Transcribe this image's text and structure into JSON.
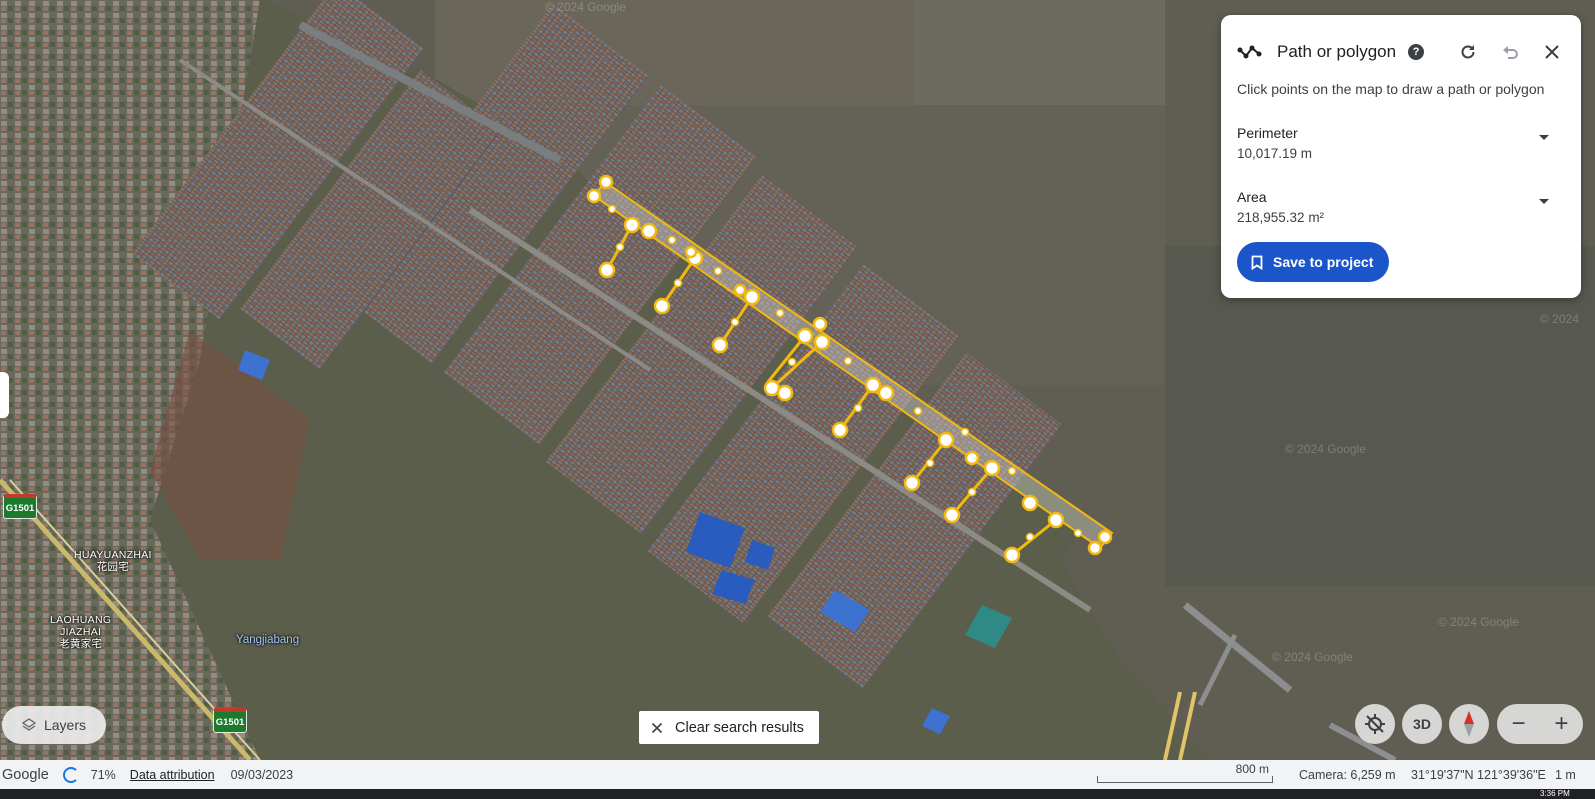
{
  "map": {
    "shields": [
      "G1501",
      "G1501"
    ],
    "places": {
      "huayuanzhai_en": "HUAYUANZHAI",
      "huayuanzhai_zh": "花园宅",
      "laohuang_en_1": "LAOHUANG",
      "laohuang_en_2": "JIAZHAI",
      "laohuang_zh": "老黄家宅",
      "road": "Yangjiabang"
    },
    "watermarks": [
      "© 2024 Google",
      "© 2024 Google",
      "© 2024 Google",
      "© 2024 Google",
      "© 2024"
    ]
  },
  "measure_panel": {
    "title": "Path or polygon",
    "help": "?",
    "hint": "Click points on the map to draw a path or polygon",
    "perimeter_label": "Perimeter",
    "perimeter_value": "10,017.19 m",
    "area_label": "Area",
    "area_value": "218,955.32 m²",
    "save_label": "Save to project",
    "icons": [
      "path-icon",
      "help-icon",
      "refresh-icon",
      "undo-icon",
      "close-icon",
      "bookmark-icon"
    ]
  },
  "controls": {
    "layers_label": "Layers",
    "clear_label": "Clear search results",
    "threed_label": "3D",
    "zoom_out": "−",
    "zoom_in": "+"
  },
  "status": {
    "brand": "Google",
    "progress": "71%",
    "attribution": "Data attribution",
    "date": "09/03/2023",
    "scale": "800 m",
    "camera": "Camera: 6,259 m",
    "coords": "31°19'37\"N 121°39'36\"E",
    "altitude": "1 m",
    "clock": "3:36 PM"
  },
  "colors": {
    "accent": "#1a56c9",
    "polygon": "#f2b90f",
    "water": "#615f52"
  }
}
